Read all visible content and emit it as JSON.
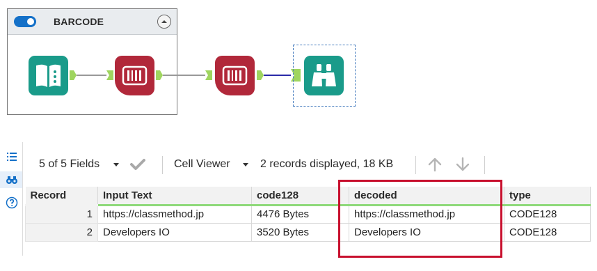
{
  "container": {
    "title": "BARCODE",
    "toggle_on": true
  },
  "tools": [
    {
      "name": "input-data-tool",
      "icon": "book-icon",
      "color": "#1a9b8a"
    },
    {
      "name": "barcode-tool-1",
      "icon": "barcode-icon",
      "color": "#b1283a"
    },
    {
      "name": "barcode-tool-2",
      "icon": "barcode-icon",
      "color": "#b1283a"
    },
    {
      "name": "browse-tool",
      "icon": "binoculars-icon",
      "color": "#1a9b8a"
    }
  ],
  "colors": {
    "anchor": "#9fd55f",
    "accent": "#1470c8",
    "highlight": "#c8102e",
    "header_underline": "#8fd97a"
  },
  "toolbar": {
    "fields_label": "5 of 5 Fields",
    "viewer_label": "Cell Viewer",
    "records_label": "2 records displayed, 18 KB"
  },
  "side_rail": {
    "icons": [
      "list-icon",
      "binoculars-icon",
      "help-icon"
    ]
  },
  "table": {
    "columns": [
      "Record",
      "Input Text",
      "code128",
      "decoded",
      "type"
    ],
    "rows": [
      [
        "1",
        "https://classmethod.jp",
        "4476 Bytes",
        "https://classmethod.jp",
        "CODE128"
      ],
      [
        "2",
        "Developers IO",
        "3520 Bytes",
        "Developers IO",
        "CODE128"
      ]
    ]
  }
}
